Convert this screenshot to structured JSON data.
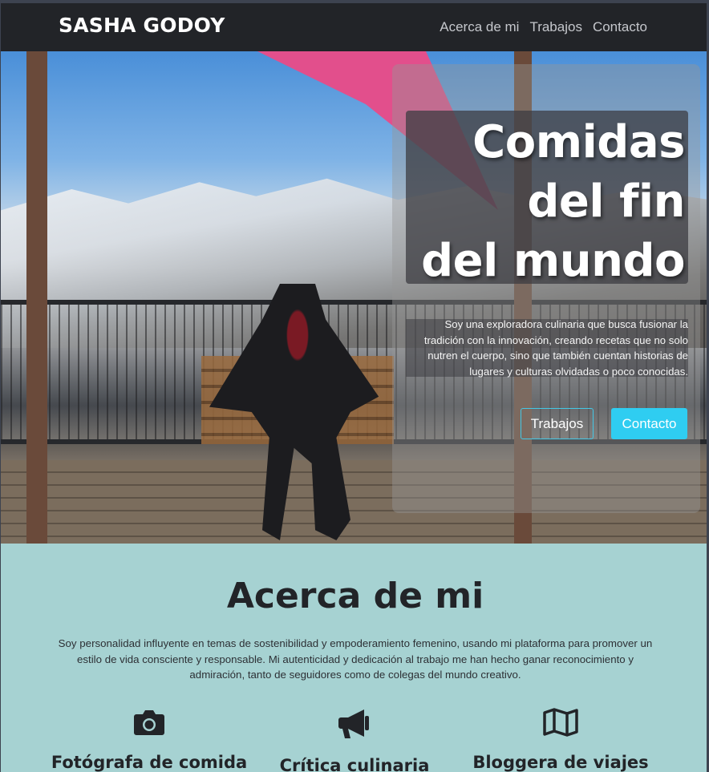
{
  "navbar": {
    "brand": "SASHA GODOY",
    "links": [
      {
        "label": "Acerca de mi"
      },
      {
        "label": "Trabajos"
      },
      {
        "label": "Contacto"
      }
    ]
  },
  "hero": {
    "title_line1": "Comidas",
    "title_line2": "del fin",
    "title_line3": "del mundo",
    "description": "Soy una exploradora culinaria que busca fusionar la tradición con la innovación, creando recetas que no solo nutren el cuerpo, sino que también cuentan historias de lugares y culturas olvidadas o poco conocidas.",
    "buttons": {
      "secondary": "Trabajos",
      "primary": "Contacto"
    },
    "image_icon": "chairlift-photo"
  },
  "about": {
    "title": "Acerca de mi",
    "text": "Soy personalidad influyente en temas de sostenibilidad y empoderamiento femenino, usando mi plataforma para promover un estilo de vida consciente y responsable. Mi autenticidad y dedicación al trabajo me han hecho ganar reconocimiento y admiración, tanto de seguidores como de colegas del mundo creativo.",
    "features": [
      {
        "icon": "camera-icon",
        "title": "Fotógrafa de comida"
      },
      {
        "icon": "megaphone-icon",
        "title": "Crítica culinaria"
      },
      {
        "icon": "map-icon",
        "title": "Bloggera de viajes"
      }
    ]
  },
  "colors": {
    "navbar_bg": "#222428",
    "accent": "#2fcdf1",
    "section_bg": "#a6d2d2",
    "text_dark": "#222428"
  }
}
